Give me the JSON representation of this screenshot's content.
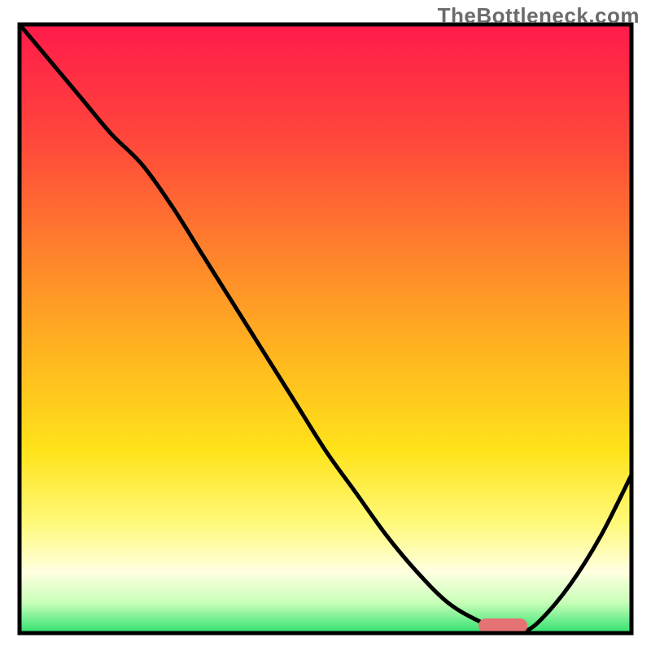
{
  "attribution": "TheBottleneck.com",
  "chart_data": {
    "type": "line",
    "title": "",
    "xlabel": "",
    "ylabel": "",
    "xlim": [
      0,
      100
    ],
    "ylim": [
      0,
      100
    ],
    "x": [
      0,
      5,
      10,
      15,
      20,
      25,
      30,
      35,
      40,
      45,
      50,
      55,
      60,
      65,
      70,
      75,
      80,
      82,
      85,
      90,
      95,
      100
    ],
    "y": [
      100,
      94,
      88,
      82,
      77,
      70,
      62,
      54,
      46,
      38,
      30,
      23,
      16,
      10,
      5,
      2,
      0,
      0,
      2,
      8,
      16,
      26
    ],
    "sweet_spot_x_range": [
      75,
      83
    ],
    "background_gradient_stops": [
      {
        "offset": 0.0,
        "color": "#ff1a4b"
      },
      {
        "offset": 0.2,
        "color": "#ff4a3a"
      },
      {
        "offset": 0.4,
        "color": "#ff8a2a"
      },
      {
        "offset": 0.55,
        "color": "#ffb81f"
      },
      {
        "offset": 0.7,
        "color": "#ffe31a"
      },
      {
        "offset": 0.82,
        "color": "#fff97a"
      },
      {
        "offset": 0.9,
        "color": "#ffffe0"
      },
      {
        "offset": 0.95,
        "color": "#c8ffb8"
      },
      {
        "offset": 1.0,
        "color": "#2fe06e"
      }
    ],
    "frame_color": "#000000",
    "curve_color": "#000000",
    "marker_color": "#e57373"
  }
}
